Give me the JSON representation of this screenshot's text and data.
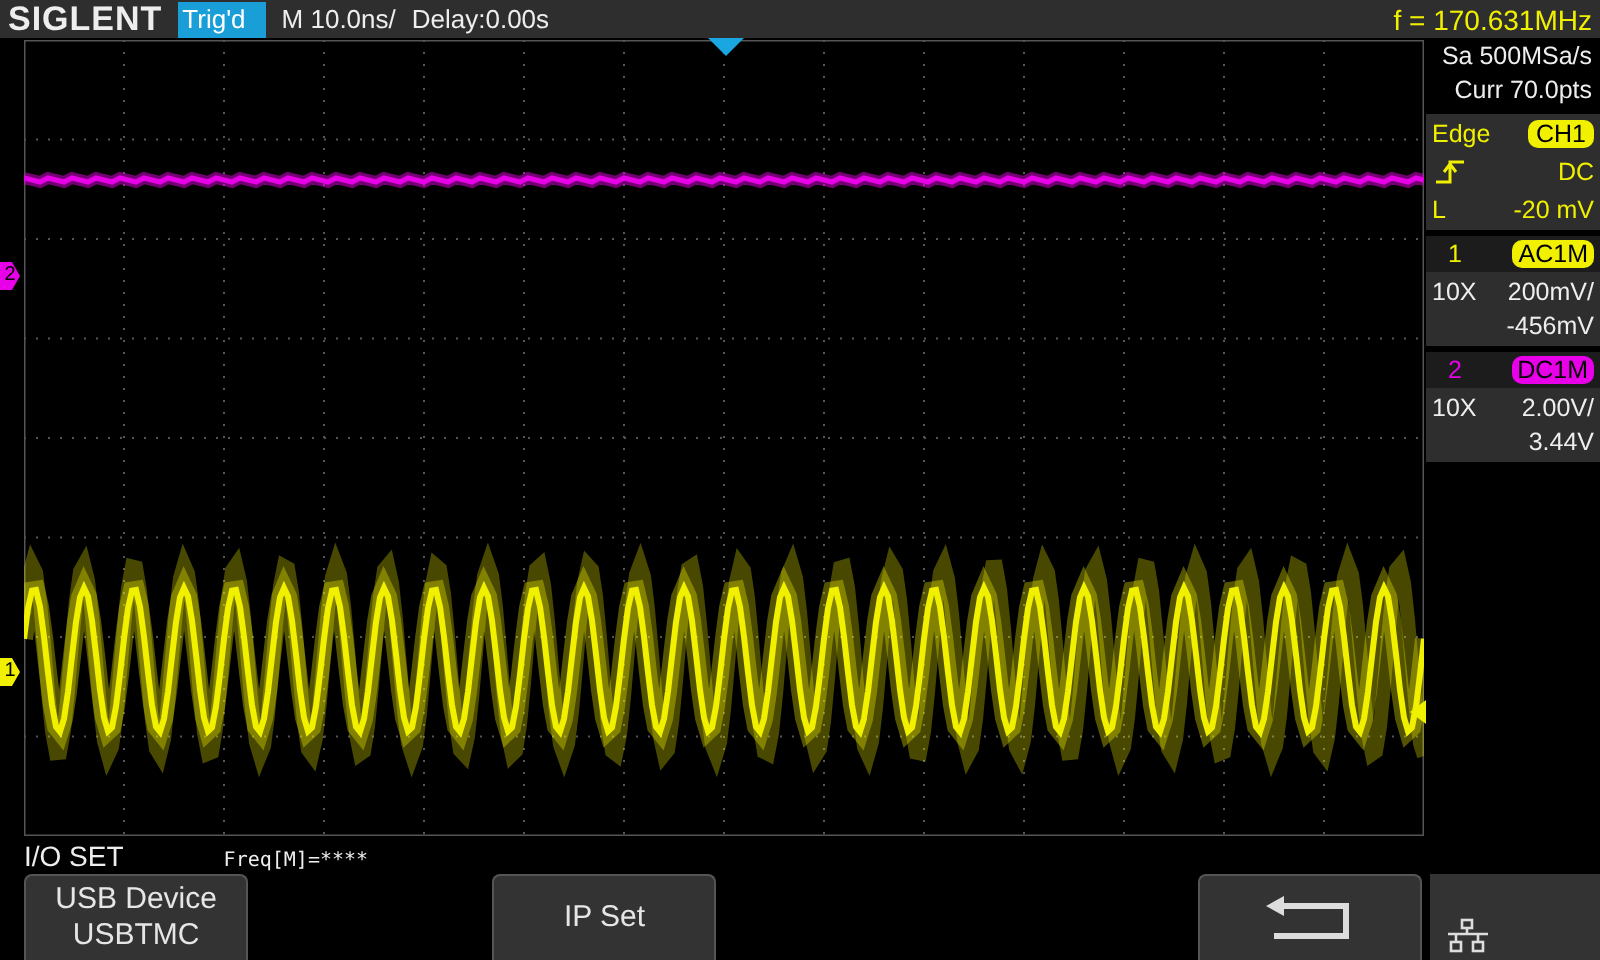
{
  "header": {
    "logo": "SIGLENT",
    "trigger_status": "Trig'd",
    "timebase": "M 10.0ns/",
    "delay": "Delay:0.00s",
    "frequency": "f = 170.631MHz"
  },
  "acquisition": {
    "sample_rate": "Sa 500MSa/s",
    "memory_depth": "Curr 70.0pts"
  },
  "trigger": {
    "type": "Edge",
    "source": "CH1",
    "coupling": "DC",
    "level_label": "L",
    "level_reading": "-20 mV"
  },
  "channels": [
    {
      "number": "1",
      "coupling": "AC1M",
      "probe": "10X",
      "scale": "200mV/",
      "offset": "-456mV",
      "color": "#f0f000"
    },
    {
      "number": "2",
      "coupling": "DC1M",
      "probe": "10X",
      "scale": "2.00V/",
      "offset": "3.44V",
      "color": "#e800e8"
    }
  ],
  "grid_markers": [
    {
      "label": "2",
      "color": "#e800e8"
    },
    {
      "label": "1",
      "color": "#f0f000"
    }
  ],
  "menu": {
    "title": "I/O SET",
    "status": "Freq[M]=****",
    "softkeys": [
      {
        "kind": "text",
        "lines": [
          "USB Device",
          "USBTMC"
        ]
      },
      {
        "kind": "empty"
      },
      {
        "kind": "text",
        "lines": [
          "IP Set"
        ]
      },
      {
        "kind": "empty"
      },
      {
        "kind": "empty"
      },
      {
        "kind": "back"
      }
    ]
  }
}
